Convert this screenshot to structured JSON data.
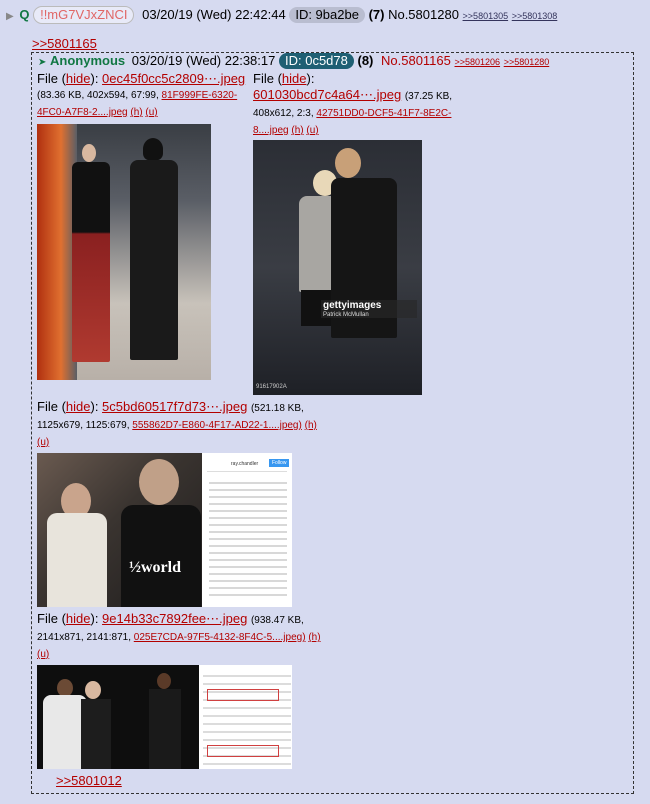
{
  "header": {
    "arrow": "▶",
    "q_name": "Q",
    "tripcode": "!!mG7VJxZNCI",
    "datetime": "03/20/19 (Wed) 22:42:44",
    "id_label": "ID: 9ba2be",
    "post_count": "(7)",
    "post_no": "No.5801280",
    "replies": [
      ">>5801305",
      ">>5801308"
    ]
  },
  "quote_link": ">>5801165",
  "embedded": {
    "marker": "➤",
    "name": "Anonymous",
    "datetime": "03/20/19 (Wed) 22:38:17",
    "id_label": "ID: 0c5d78",
    "post_count": "(8)",
    "post_no": "No.5801165",
    "replies": [
      ">>5801206",
      ">>5801280"
    ]
  },
  "files": [
    {
      "file_label": "File",
      "hide": "hide",
      "name": "0ec45f0cc5c2809⋯.jpeg",
      "line2": "(83.36 KB, 402x594, 67:99,",
      "orig_a": "81F999FE-6320-",
      "orig_b": "4FC0-A7F8-2....jpeg",
      "h": "(h)",
      "u": "(u)",
      "image_alt": "Photo: couple at event"
    },
    {
      "file_label": "File",
      "hide": "hide",
      "name": "601030bcd7c4a64⋯.jpeg",
      "size": "(37.25 KB,",
      "line3": "408x612, 2:3,",
      "orig_a": "42751DD0-DCF5-41F7-8E2C-",
      "orig_b": "8....jpeg",
      "h": "(h)",
      "u": "(u)",
      "watermark": "gettyimages",
      "watermark_sub": "Patrick McMullan",
      "corner_code": "91617902A"
    },
    {
      "file_label": "File",
      "hide": "hide",
      "name": "5c5bd60517f7d73⋯.jpeg",
      "size": "(521.18 KB,",
      "line2": "1125x679, 1125:679,",
      "orig": "555862D7-E860-4F17-AD22-1....jpeg)",
      "h": "(h)",
      "u": "(u)",
      "screenshot_user": "ray.chandler",
      "follow": "Follow",
      "shirt_text": "½world"
    },
    {
      "file_label": "File",
      "hide": "hide",
      "name": "9e14b33c7892fee⋯.jpeg",
      "size": "(938.47 KB,",
      "line2": "2141x871, 2141:871,",
      "orig": "025E7CDA-97F5-4132-8F4C-5....jpeg)",
      "h": "(h)",
      "u": "(u)"
    }
  ],
  "bottom_link": ">>5801012",
  "colors": {
    "background": "#d6daf0",
    "link": "#b30000",
    "name_green": "#117743",
    "id_gray": "#b9bdd0",
    "id_teal": "#1f5f73"
  }
}
